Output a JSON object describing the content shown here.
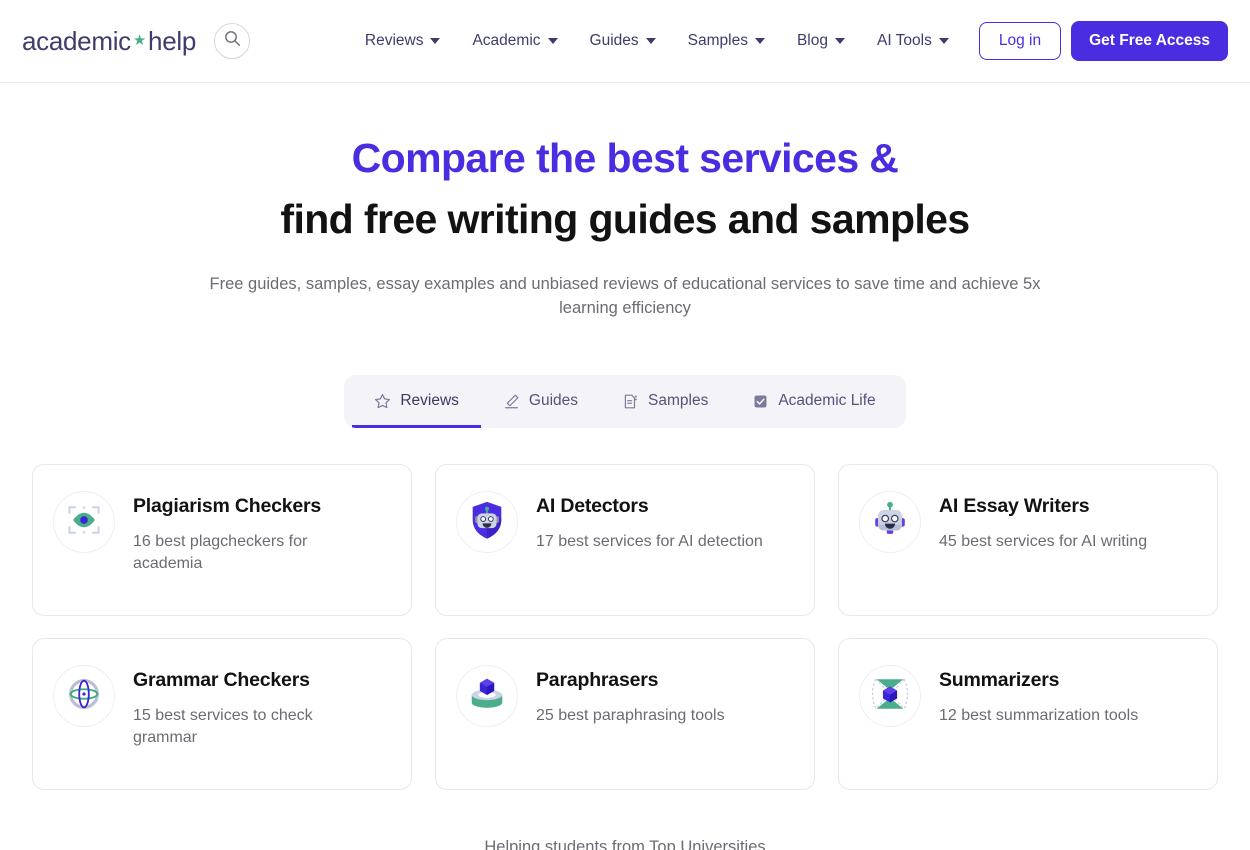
{
  "header": {
    "logo": {
      "part1": "academic",
      "star": "★",
      "part2": "help"
    },
    "search_icon": "search-icon",
    "nav": [
      {
        "label": "Reviews",
        "has_caret": true
      },
      {
        "label": "Academic",
        "has_caret": true
      },
      {
        "label": "Guides",
        "has_caret": true
      },
      {
        "label": "Samples",
        "has_caret": true
      },
      {
        "label": "Blog",
        "has_caret": true
      },
      {
        "label": "AI Tools",
        "has_caret": true
      }
    ],
    "login_label": "Log in",
    "cta_label": "Get Free Access"
  },
  "hero": {
    "headline_line1": "Compare the best services &",
    "headline_line2": "find free writing guides and samples",
    "subhead": "Free guides, samples, essay examples and unbiased reviews of educational services to save time and achieve 5x learning efficiency"
  },
  "tabs": [
    {
      "label": "Reviews",
      "icon": "star-icon",
      "active": true
    },
    {
      "label": "Guides",
      "icon": "pencil-icon",
      "active": false
    },
    {
      "label": "Samples",
      "icon": "document-icon",
      "active": false
    },
    {
      "label": "Academic Life",
      "icon": "checkbox-icon",
      "active": false
    }
  ],
  "cards": [
    {
      "title": "Plagiarism Checkers",
      "subtitle": "16 best plagcheckers for academia",
      "icon": "eye-scan-icon"
    },
    {
      "title": "AI Detectors",
      "subtitle": "17 best services for AI detection",
      "icon": "shield-robot-icon"
    },
    {
      "title": "AI Essay Writers",
      "subtitle": "45 best services for AI writing",
      "icon": "robot-head-icon"
    },
    {
      "title": "Grammar Checkers",
      "subtitle": "15 best services to check grammar",
      "icon": "atom-circle-icon"
    },
    {
      "title": "Paraphrasers",
      "subtitle": "25 best paraphrasing tools",
      "icon": "cube-cylinder-icon"
    },
    {
      "title": "Summarizers",
      "subtitle": "12 best summarization tools",
      "icon": "hourglass-cube-icon"
    }
  ],
  "footnote": "Helping students from Top Universities",
  "colors": {
    "brand_purple": "#4a2de0",
    "logo_navy": "#3d3d6b",
    "accent_green": "#4aae8c",
    "text_muted": "#6b6b73"
  }
}
